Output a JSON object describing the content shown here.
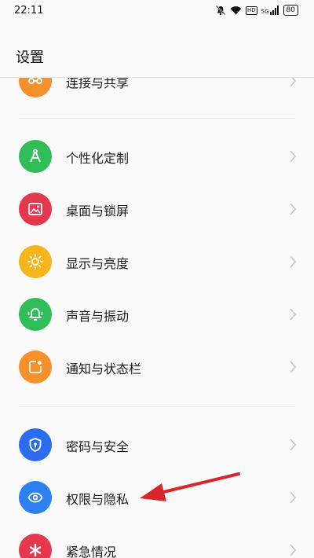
{
  "status_bar": {
    "time": "22:11",
    "hd_label": "HD",
    "signal_label": "5G",
    "battery": "80"
  },
  "header": {
    "title": "设置"
  },
  "items": [
    {
      "label": "连接与共享",
      "icon": "share-icon",
      "color": "#f5902b"
    },
    {
      "label": "个性化定制",
      "icon": "brush-icon",
      "color": "#2fbd58"
    },
    {
      "label": "桌面与锁屏",
      "icon": "picture-icon",
      "color": "#e5384f"
    },
    {
      "label": "显示与亮度",
      "icon": "sun-icon",
      "color": "#f6b51a"
    },
    {
      "label": "声音与振动",
      "icon": "bell-icon",
      "color": "#2fbd58"
    },
    {
      "label": "通知与状态栏",
      "icon": "notification-icon",
      "color": "#f5902b"
    },
    {
      "label": "密码与安全",
      "icon": "shield-icon",
      "color": "#2c6cf0"
    },
    {
      "label": "权限与隐私",
      "icon": "eye-icon",
      "color": "#2c80f0"
    },
    {
      "label": "紧急情况",
      "icon": "asterisk-icon",
      "color": "#e5384f"
    }
  ],
  "annotation": {
    "arrow_color": "#d9262b"
  }
}
